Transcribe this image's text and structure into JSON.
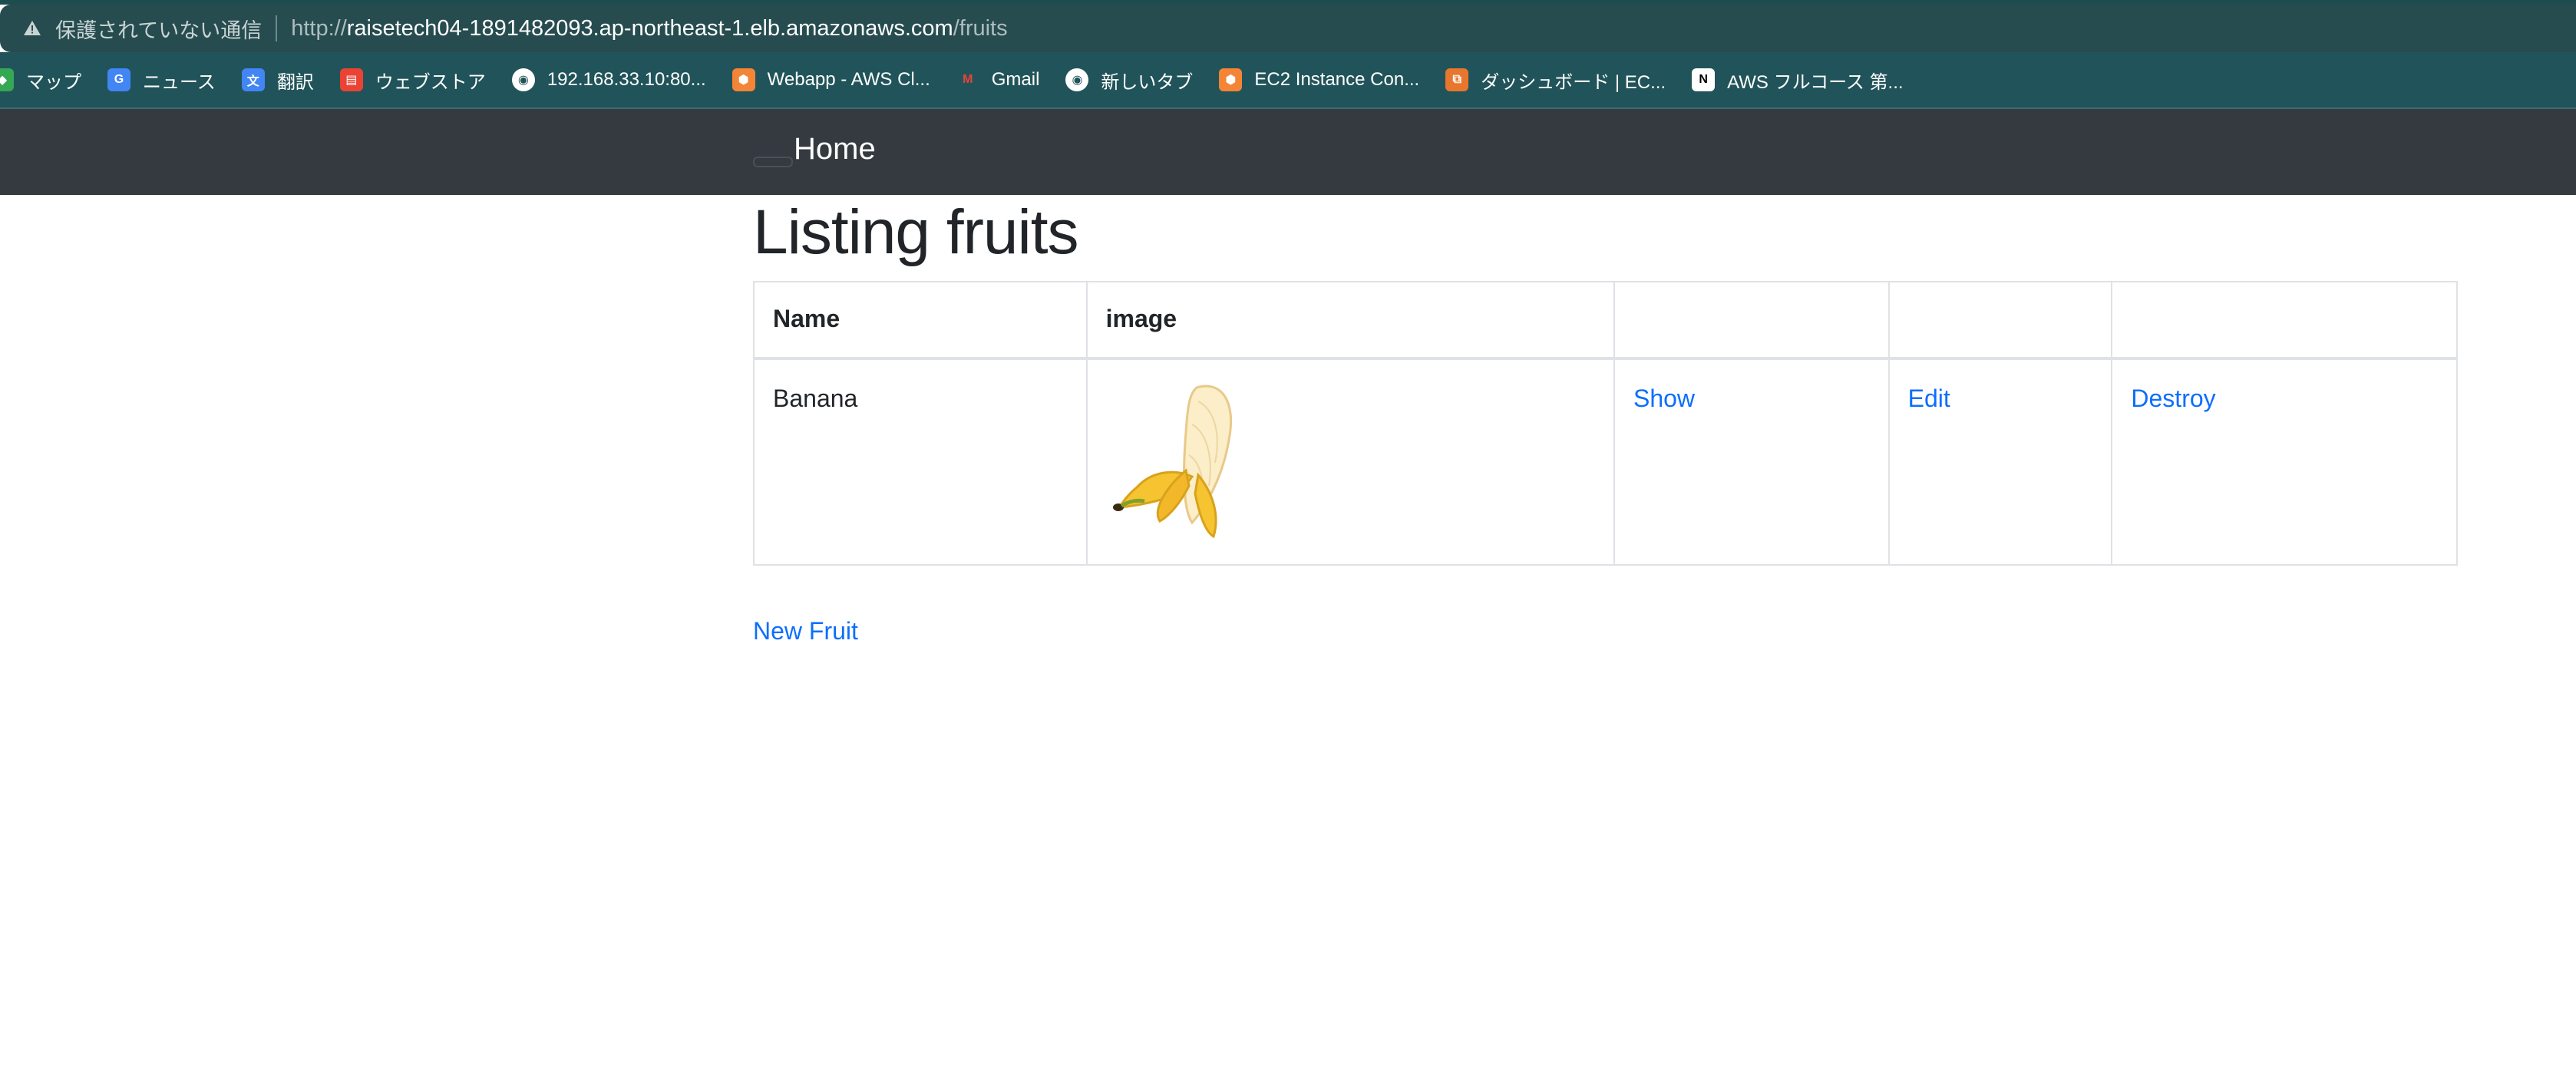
{
  "browser": {
    "security_label": "保護されていない通信",
    "url_scheme": "http://",
    "url_host": "raisetech04-1891482093.ap-northeast-1.elb.amazonaws.com",
    "url_path": "/fruits",
    "bookmarks": [
      {
        "label": "マップ",
        "icon": "maps-icon",
        "color": "#34a853"
      },
      {
        "label": "ニュース",
        "icon": "news-icon",
        "color": "#4285f4"
      },
      {
        "label": "翻訳",
        "icon": "translate-icon",
        "color": "#4285f4"
      },
      {
        "label": "ウェブストア",
        "icon": "webstore-icon",
        "color": "#ea4335"
      },
      {
        "label": "192.168.33.10:80...",
        "icon": "globe-icon",
        "color": "#ffffff"
      },
      {
        "label": "Webapp - AWS Cl...",
        "icon": "aws-cloud9-icon",
        "color": "#f58536"
      },
      {
        "label": "Gmail",
        "icon": "gmail-icon",
        "color": "#ea4335"
      },
      {
        "label": "新しいタブ",
        "icon": "globe-icon",
        "color": "#ffffff"
      },
      {
        "label": "EC2 Instance Con...",
        "icon": "aws-ec2-icon",
        "color": "#f58536"
      },
      {
        "label": "ダッシュボード | EC...",
        "icon": "aws-dashboard-icon",
        "color": "#e8762d"
      },
      {
        "label": "AWS フルコース 第...",
        "icon": "notion-icon",
        "color": "#000000"
      }
    ]
  },
  "navbar": {
    "brand": "Home"
  },
  "page": {
    "title": "Listing fruits",
    "table": {
      "headers": [
        "Name",
        "image",
        "",
        "",
        ""
      ],
      "rows": [
        {
          "name": "Banana",
          "image": "banana-image",
          "show": "Show",
          "edit": "Edit",
          "destroy": "Destroy"
        }
      ]
    },
    "new_link": "New Fruit"
  }
}
